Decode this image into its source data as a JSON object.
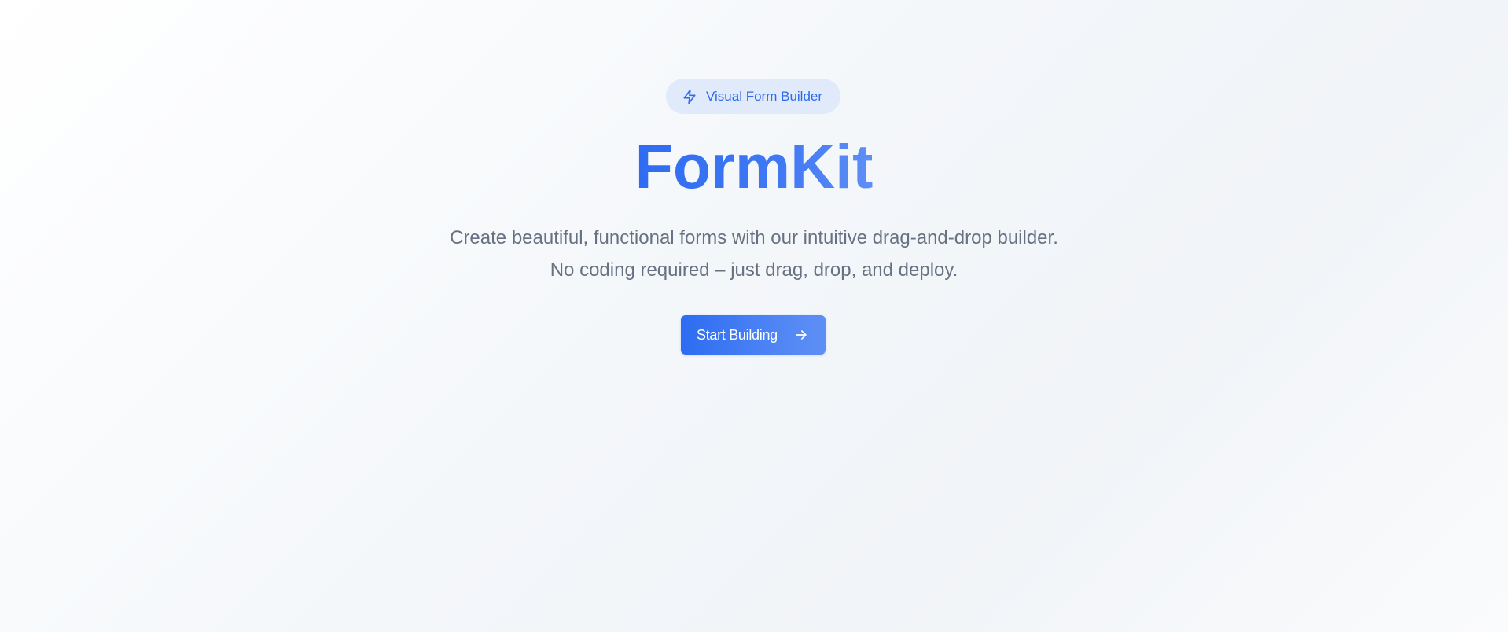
{
  "badge": {
    "icon": "lightning-bolt-icon",
    "label": "Visual Form Builder"
  },
  "hero": {
    "title": "FormKit",
    "subtitle_line1": "Create beautiful, functional forms with our intuitive drag-and-drop builder.",
    "subtitle_line2": "No coding required – just drag, drop, and deploy."
  },
  "cta": {
    "label": "Start Building",
    "icon": "arrow-right-icon"
  },
  "colors": {
    "accent": "#2F6CF2",
    "accent_light": "#5F8FF5",
    "badge_bg": "#E1EAFA",
    "text_muted": "#687182"
  }
}
